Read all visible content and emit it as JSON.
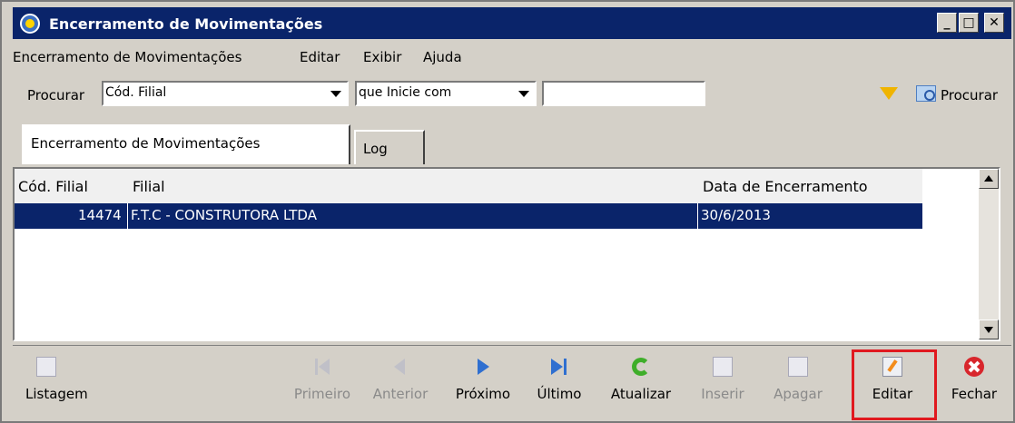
{
  "window": {
    "title": "Encerramento de Movimentações"
  },
  "menu": {
    "items": [
      {
        "label": "Encerramento de Movimentações"
      },
      {
        "label": "Editar"
      },
      {
        "label": "Exibir"
      },
      {
        "label": "Ajuda"
      }
    ]
  },
  "search": {
    "label": "Procurar",
    "field": "Cód. Filial",
    "condition": "que Inicie com",
    "value": "",
    "button_label": "Procurar"
  },
  "tabs": [
    {
      "label": "Encerramento de Movimentações",
      "active": true
    },
    {
      "label": "Log",
      "active": false
    }
  ],
  "grid": {
    "columns": [
      "Cód. Filial",
      "Filial",
      "Data de Encerramento"
    ],
    "rows": [
      {
        "cod": "14474",
        "filial": "F.T.C - CONSTRUTORA LTDA",
        "data": "30/6/2013",
        "selected": true
      }
    ]
  },
  "toolbar": {
    "listagem": "Listagem",
    "primeiro": "Primeiro",
    "anterior": "Anterior",
    "proximo": "Próximo",
    "ultimo": "Último",
    "atualizar": "Atualizar",
    "inserir": "Inserir",
    "apagar": "Apagar",
    "editar": "Editar",
    "fechar": "Fechar"
  },
  "colors": {
    "titlebar": "#0a246a",
    "selection": "#0a246a",
    "highlight": "#e0191f"
  }
}
